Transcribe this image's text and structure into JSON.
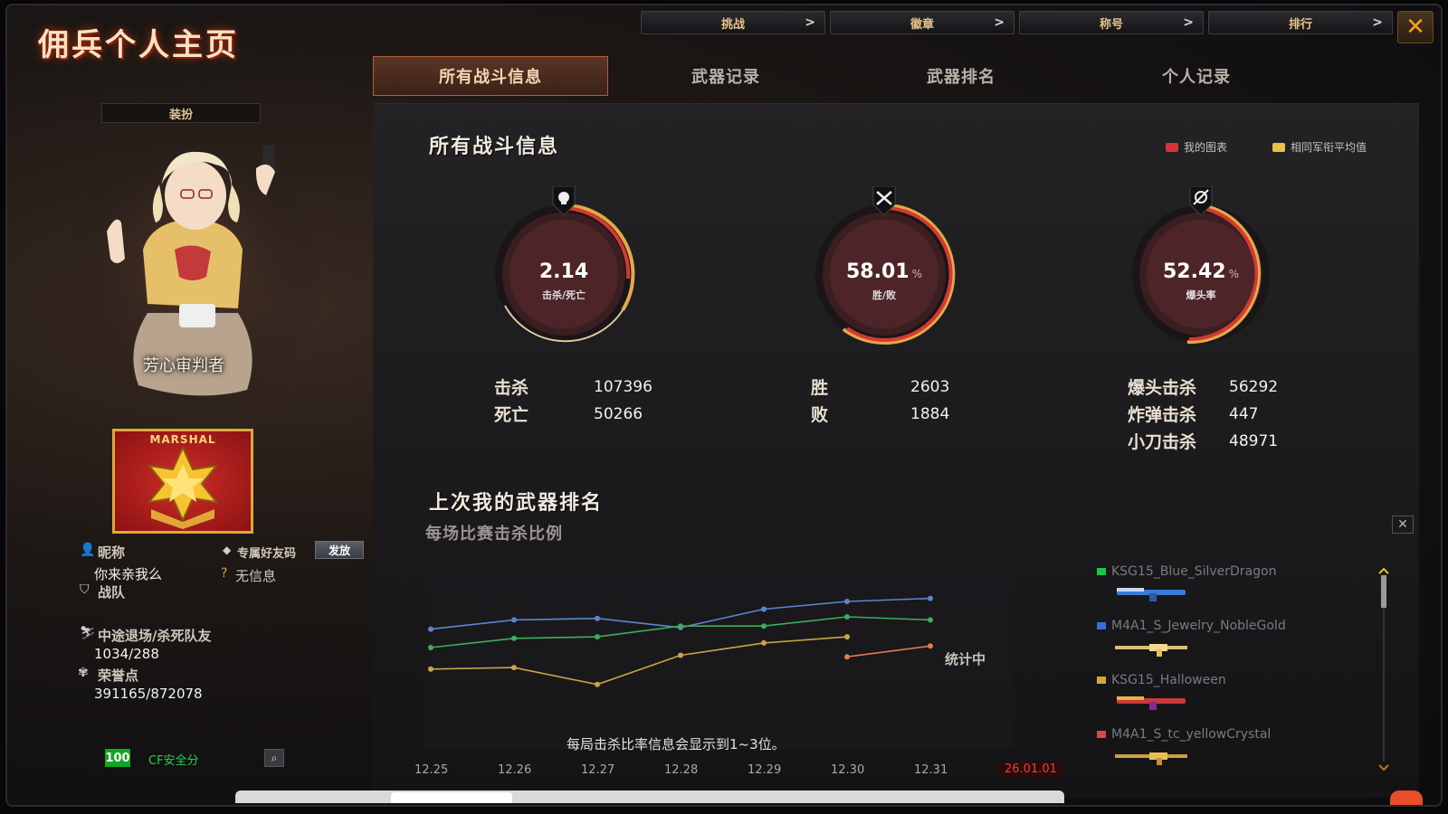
{
  "app": {
    "title": "佣兵个人主页"
  },
  "topnav": [
    {
      "label": "挑战"
    },
    {
      "label": "徽章"
    },
    {
      "label": "称号"
    },
    {
      "label": "排行"
    }
  ],
  "topnav_chevron": ">",
  "close_label": "✕",
  "tabs": [
    {
      "label": "所有战斗信息"
    },
    {
      "label": "武器记录"
    },
    {
      "label": "武器排名"
    },
    {
      "label": "个人记录"
    }
  ],
  "left": {
    "outfit_label": "装扮",
    "character_name": "芳心审判者",
    "rank_badge": "MARSHAL",
    "nickname_label": "昵称",
    "nickname": "你来亲我么",
    "friend_code_label": "专属好友码",
    "send_button": "发放",
    "no_info": "无信息",
    "team_label": "战队",
    "quit_label": "中途退场/杀死队友",
    "quit_value": "1034/288",
    "honor_label": "荣誉点",
    "honor_value": "391165/872078",
    "security_score": "100",
    "security_label": "CF安全分"
  },
  "main": {
    "title": "所有战斗信息",
    "legend": [
      {
        "label": "我的图表",
        "color": "#d6333a"
      },
      {
        "label": "相同军衔平均值",
        "color": "#e8c04a"
      }
    ],
    "gauges": [
      {
        "value": "2.14",
        "unit": "",
        "label": "击杀/死亡",
        "icon": "skull-icon"
      },
      {
        "value": "58.01",
        "unit": "%",
        "label": "胜/败",
        "icon": "crossed-guns-icon"
      },
      {
        "value": "52.42",
        "unit": "%",
        "label": "爆头率",
        "icon": "crosshair-icon"
      }
    ],
    "kd": {
      "kill_label": "击杀",
      "kill": "107396",
      "death_label": "死亡",
      "death": "50266"
    },
    "wl": {
      "win_label": "胜",
      "win": "2603",
      "loss_label": "败",
      "loss": "1884"
    },
    "special": {
      "headshot_label": "爆头击杀",
      "headshot": "56292",
      "bomb_label": "炸弹击杀",
      "bomb": "447",
      "knife_label": "小刀击杀",
      "knife": "48971"
    },
    "rank_title": "上次我的武器排名",
    "chart_subtitle": "每场比赛击杀比例",
    "chart_status": "统计中",
    "chart_note": "每局击杀比率信息会显示到1~3位。",
    "weapons": [
      {
        "name": "KSG15_Blue_SilverDragon",
        "color": "#22c24a"
      },
      {
        "name": "M4A1_S_Jewelry_NobleGold",
        "color": "#3a6fd8"
      },
      {
        "name": "KSG15_Halloween",
        "color": "#d8a630"
      },
      {
        "name": "M4A1_S_tc_yellowCrystal",
        "color": "#d84848"
      }
    ],
    "close_x": "✕"
  },
  "chart_data": {
    "type": "line",
    "categories": [
      "12.25",
      "12.26",
      "12.27",
      "12.28",
      "12.29",
      "12.30",
      "12.31",
      "26.01.01"
    ],
    "series": [
      {
        "values": [
          0.72,
          0.78,
          0.79,
          0.73,
          0.85,
          0.9,
          0.92,
          null
        ],
        "color": "#5a86d0"
      },
      {
        "values": [
          0.6,
          0.66,
          0.67,
          0.74,
          0.74,
          0.8,
          0.78,
          null
        ],
        "color": "#3cae5c"
      },
      {
        "values": [
          0.46,
          0.47,
          0.36,
          0.55,
          0.63,
          0.67,
          null,
          null
        ],
        "color": "#c9a44a"
      },
      {
        "values": [
          null,
          null,
          null,
          null,
          null,
          0.54,
          0.61,
          null
        ],
        "color": "#e07a50"
      }
    ],
    "highlighted_category": "26.01.01"
  }
}
